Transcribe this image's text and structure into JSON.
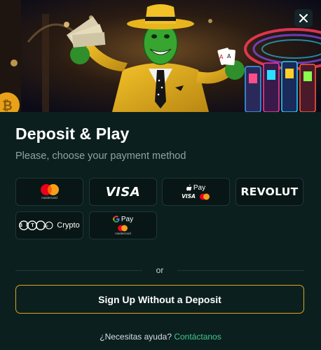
{
  "modal": {
    "title": "Deposit & Play",
    "subtitle": "Please, choose your payment method",
    "close_icon": "close-icon"
  },
  "payment_methods": {
    "mastercard": {
      "caption": "mastercard"
    },
    "visa": {
      "label": "VISA"
    },
    "applepay": {
      "label": "Pay",
      "sub_visa": "VISA"
    },
    "revolut": {
      "label": "REVOLUT"
    },
    "crypto": {
      "logo": "BIT",
      "suffix": "pro",
      "label": "Crypto"
    },
    "googlepay": {
      "label": "Pay",
      "caption": "mastercard"
    }
  },
  "divider": {
    "text": "or"
  },
  "signup": {
    "label": "Sign Up Without a Deposit"
  },
  "help": {
    "question": "¿Necesitas ayuda?",
    "link": "Contáctanos"
  },
  "colors": {
    "background": "#0c1f1f",
    "card_bg": "#081616",
    "card_border": "#1f3636",
    "accent_gold": "#d9a521",
    "link_green": "#3fc98a",
    "subtitle_gray": "#8fa3a3"
  }
}
